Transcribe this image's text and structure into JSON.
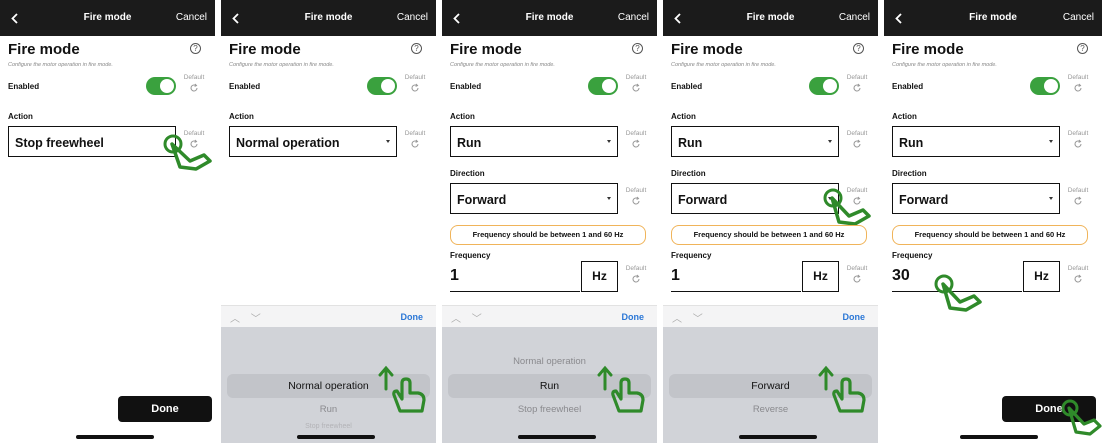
{
  "colors": {
    "toggle_on": "#3aa13e",
    "nav_bg": "#1b1b1b",
    "done_link": "#2b77d6",
    "warning_border": "#f0b45a",
    "gesture": "#2f8a2a"
  },
  "nav": {
    "back_icon": "chevron-left-icon",
    "title": "Fire mode",
    "cancel": "Cancel"
  },
  "page": {
    "heading": "Fire mode",
    "help_icon": "help-circle-icon",
    "help_glyph": "?",
    "subtitle": "Configure the motor operation in fire mode.",
    "enabled_label": "Enabled",
    "enabled_on": true,
    "default_label": "Default",
    "reset_icon": "reset-icon",
    "action_label": "Action",
    "direction_label": "Direction",
    "frequency_label": "Frequency",
    "frequency_unit": "Hz",
    "frequency_warning": "Frequency should be between 1 and 60 Hz"
  },
  "screens": [
    {
      "action_value": "Stop freewheel",
      "done_button": "Done"
    },
    {
      "action_value": "Normal operation",
      "toolbar": {
        "arrows": "︿ ﹀",
        "done": "Done"
      },
      "picker": [
        "Normal operation",
        "Run",
        "Stop freewheel"
      ]
    },
    {
      "action_value": "Run",
      "direction_value": "Forward",
      "frequency_value": "1",
      "toolbar": {
        "arrows": "︿ ﹀",
        "done": "Done"
      },
      "picker": [
        "Normal operation",
        "Run",
        "Stop freewheel"
      ]
    },
    {
      "action_value": "Run",
      "direction_value": "Forward",
      "frequency_value": "1",
      "toolbar": {
        "arrows": "︿ ﹀",
        "done": "Done"
      },
      "picker": [
        "Forward",
        "Reverse"
      ]
    },
    {
      "action_value": "Run",
      "direction_value": "Forward",
      "frequency_value": "30",
      "done_button": "Done"
    }
  ],
  "gesture_icons": [
    "tap-gesture-icon",
    "swipe-up-gesture-icon"
  ]
}
